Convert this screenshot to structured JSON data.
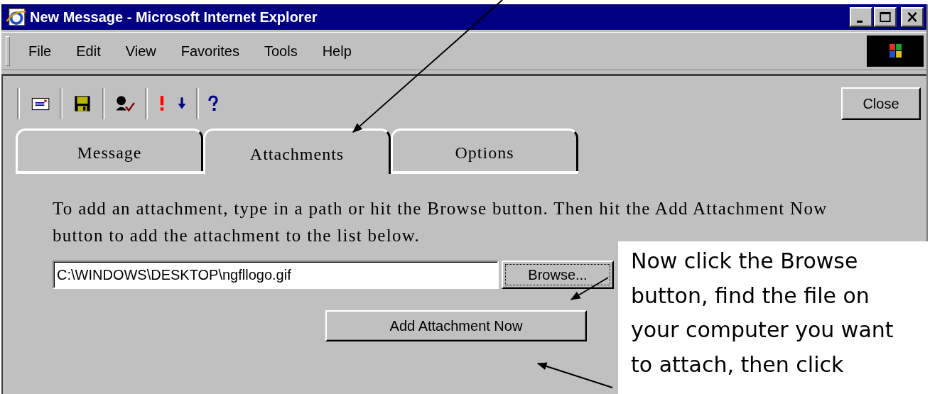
{
  "window": {
    "title": "New Message - Microsoft Internet Explorer"
  },
  "menu": [
    "File",
    "Edit",
    "View",
    "Favorites",
    "Tools",
    "Help"
  ],
  "close_button": "Close",
  "tabs": [
    {
      "label": "Message",
      "selected": false
    },
    {
      "label": "Attachments",
      "selected": true
    },
    {
      "label": "Options",
      "selected": false
    }
  ],
  "instructions": "To add an attachment, type in a path or hit the Browse button. Then hit the Add Attachment Now button to add the attachment to the list below.",
  "path_field": {
    "value": "C:\\WINDOWS\\DESKTOP\\ngfllogo.gif"
  },
  "browse_button": "Browse...",
  "add_button": "Add Attachment Now",
  "callout": "Now click the Browse button, find the file on your computer you want to attach, then click"
}
